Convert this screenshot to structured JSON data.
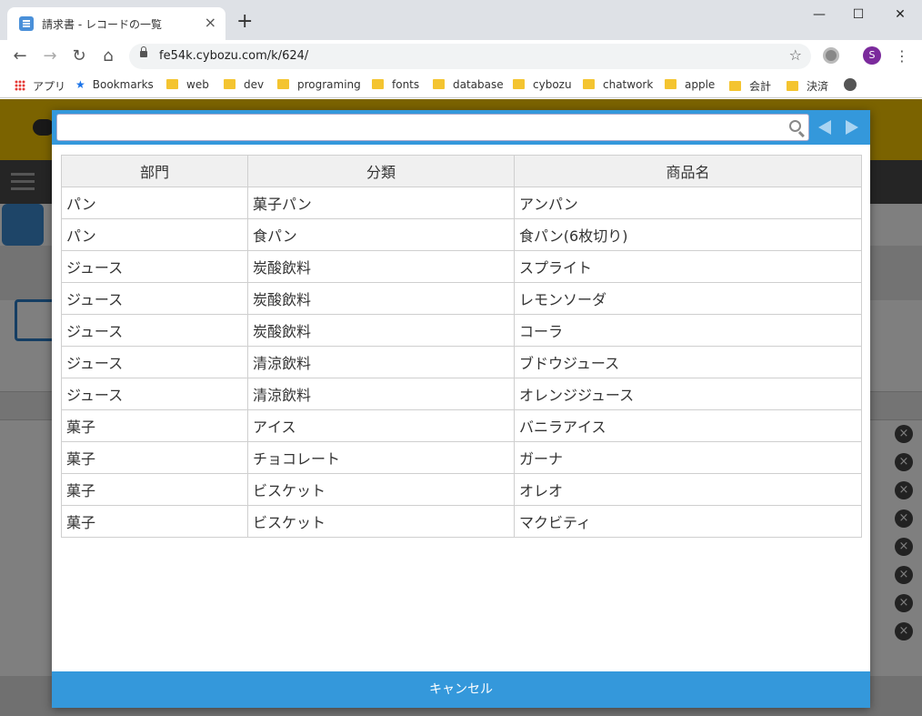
{
  "browser": {
    "tab_title": "請求書 - レコードの一覧",
    "tab_close": "×",
    "new_tab": "+",
    "url": "fe54k.cybozu.com/k/624/",
    "profile_initial": "S",
    "window_controls": {
      "minimize": "—",
      "maximize": "☐",
      "close": "✕"
    },
    "bookmarks": [
      {
        "label": "アプリ",
        "icon": "apps-grid-icon"
      },
      {
        "label": "Bookmarks",
        "icon": "star-icon"
      },
      {
        "label": "web",
        "icon": "folder-icon"
      },
      {
        "label": "dev",
        "icon": "folder-icon"
      },
      {
        "label": "programing",
        "icon": "folder-icon"
      },
      {
        "label": "fonts",
        "icon": "folder-icon"
      },
      {
        "label": "database",
        "icon": "folder-icon"
      },
      {
        "label": "cybozu",
        "icon": "folder-icon"
      },
      {
        "label": "chatwork",
        "icon": "folder-icon"
      },
      {
        "label": "apple",
        "icon": "folder-icon"
      },
      {
        "label": "会計",
        "icon": "folder-icon"
      },
      {
        "label": "決済",
        "icon": "folder-icon"
      }
    ]
  },
  "dialog": {
    "search_value": "",
    "columns": [
      "部門",
      "分類",
      "商品名"
    ],
    "rows": [
      [
        "パン",
        "菓子パン",
        "アンパン"
      ],
      [
        "パン",
        "食パン",
        "食パン(6枚切り)"
      ],
      [
        "ジュース",
        "炭酸飲料",
        "スプライト"
      ],
      [
        "ジュース",
        "炭酸飲料",
        "レモンソーダ"
      ],
      [
        "ジュース",
        "炭酸飲料",
        "コーラ"
      ],
      [
        "ジュース",
        "清涼飲料",
        "ブドウジュース"
      ],
      [
        "ジュース",
        "清涼飲料",
        "オレンジジュース"
      ],
      [
        "菓子",
        "アイス",
        "バニラアイス"
      ],
      [
        "菓子",
        "チョコレート",
        "ガーナ"
      ],
      [
        "菓子",
        "ビスケット",
        "オレオ"
      ],
      [
        "菓子",
        "ビスケット",
        "マクビティ"
      ]
    ],
    "cancel_label": "キャンセル"
  },
  "colors": {
    "dialog_accent": "#3498db",
    "kintone_header": "#f7c600",
    "profile": "#7b2a9c"
  }
}
